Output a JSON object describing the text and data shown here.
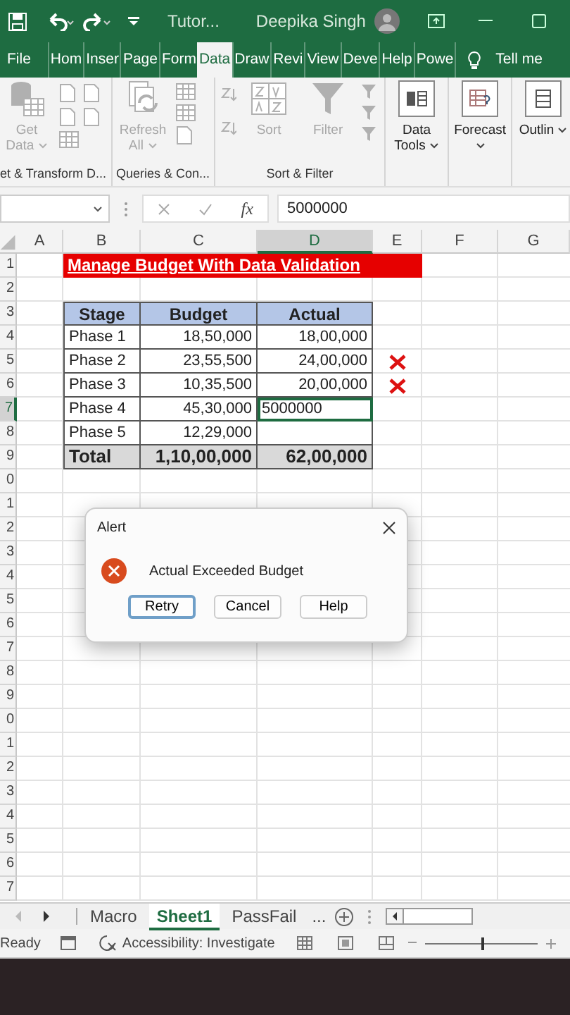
{
  "title_bar": {
    "file_name": "Tutor...",
    "user_name": "Deepika Singh"
  },
  "ribbon_tabs": [
    {
      "label": "File",
      "selected": false
    },
    {
      "label": "Hom",
      "selected": false
    },
    {
      "label": "Inser",
      "selected": false
    },
    {
      "label": "Page",
      "selected": false
    },
    {
      "label": "Form",
      "selected": false
    },
    {
      "label": "Data",
      "selected": true
    },
    {
      "label": "Draw",
      "selected": false
    },
    {
      "label": "Revi",
      "selected": false
    },
    {
      "label": "View",
      "selected": false
    },
    {
      "label": "Deve",
      "selected": false
    },
    {
      "label": "Help",
      "selected": false
    },
    {
      "label": "Powe",
      "selected": false
    }
  ],
  "tell_me": "Tell me",
  "ribbon_groups": [
    {
      "label": "et & Transform D...",
      "buttons": [
        {
          "kind": "database",
          "label": "Get Data",
          "disabled": true,
          "caret": true
        }
      ],
      "kind": "docs"
    },
    {
      "label": "Queries & Con...",
      "buttons": [
        {
          "kind": "refresh",
          "label": "Refresh All",
          "disabled": true,
          "caret": true
        }
      ],
      "kind": "list"
    },
    {
      "label": "Sort & Filter",
      "buttons": [
        {
          "kind": "sort",
          "label": "Sort",
          "disabled": true,
          "caret": false
        },
        {
          "kind": "filter",
          "label": "Filter",
          "disabled": true,
          "caret": false
        }
      ],
      "kind": "filters"
    },
    {
      "buttons": [
        {
          "kind": "tools",
          "label": "Data Tools",
          "disabled": false,
          "caret": true
        }
      ]
    },
    {
      "buttons": [
        {
          "kind": "forecast",
          "label": "Forecast",
          "disabled": false,
          "caret": true
        }
      ]
    },
    {
      "buttons": [
        {
          "kind": "outline",
          "label": "Outlin",
          "disabled": false,
          "caret": true
        }
      ]
    }
  ],
  "formula_bar": {
    "function_label": "fx",
    "value": "5000000"
  },
  "columns": [
    {
      "label": "A",
      "selected": false
    },
    {
      "label": "B",
      "selected": false
    },
    {
      "label": "C",
      "selected": false
    },
    {
      "label": "D",
      "selected": true
    },
    {
      "label": "E",
      "selected": false
    },
    {
      "label": "F",
      "selected": false
    },
    {
      "label": "G",
      "selected": false
    }
  ],
  "row_headers": [
    {
      "label": "1",
      "selected": false
    },
    {
      "label": "2",
      "selected": false
    },
    {
      "label": "3",
      "selected": false
    },
    {
      "label": "4",
      "selected": false
    },
    {
      "label": "5",
      "selected": false
    },
    {
      "label": "6",
      "selected": false
    },
    {
      "label": "7",
      "selected": true
    },
    {
      "label": "8",
      "selected": false
    },
    {
      "label": "9",
      "selected": false
    },
    {
      "label": "0",
      "selected": false
    },
    {
      "label": "1",
      "selected": false
    },
    {
      "label": "2",
      "selected": false
    },
    {
      "label": "3",
      "selected": false
    },
    {
      "label": "4",
      "selected": false
    },
    {
      "label": "5",
      "selected": false
    },
    {
      "label": "6",
      "selected": false
    },
    {
      "label": "7",
      "selected": false
    },
    {
      "label": "8",
      "selected": false
    },
    {
      "label": "9",
      "selected": false
    },
    {
      "label": "0",
      "selected": false
    },
    {
      "label": "1",
      "selected": false
    },
    {
      "label": "2",
      "selected": false
    },
    {
      "label": "3",
      "selected": false
    },
    {
      "label": "4",
      "selected": false
    },
    {
      "label": "5",
      "selected": false
    },
    {
      "label": "6",
      "selected": false
    },
    {
      "label": "7",
      "selected": false
    }
  ],
  "sheet_title": "Manage Budget With Data Validation",
  "table": {
    "columns": [
      "Stage",
      "Budget",
      "Actual"
    ],
    "rows": [
      {
        "stage": "Phase 1",
        "budget": "18,50,000",
        "actual": "18,00,000",
        "exceeded": false,
        "active": false
      },
      {
        "stage": "Phase 2",
        "budget": "23,55,500",
        "actual": "24,00,000",
        "exceeded": true,
        "active": false
      },
      {
        "stage": "Phase 3",
        "budget": "10,35,500",
        "actual": "20,00,000",
        "exceeded": true,
        "active": false
      },
      {
        "stage": "Phase 4",
        "budget": "45,30,000",
        "actual": "5000000",
        "exceeded": false,
        "active": true
      },
      {
        "stage": "Phase 5",
        "budget": "12,29,000",
        "exceeded": false,
        "active": false
      }
    ],
    "total": {
      "label": "Total",
      "budget": "1,10,00,000",
      "actual": "62,00,000"
    }
  },
  "dialog": {
    "title": "Alert",
    "message": "Actual Exceeded Budget",
    "buttons": [
      {
        "label": "Retry",
        "focused": true
      },
      {
        "label": "Cancel",
        "focused": false
      },
      {
        "label": "Help",
        "focused": false
      }
    ]
  },
  "sheet_tabs": [
    {
      "label": "Macro",
      "selected": false
    },
    {
      "label": "Sheet1",
      "selected": true
    },
    {
      "label": "PassFail",
      "selected": false
    }
  ],
  "more_sheets": "...",
  "status_bar": {
    "state": "Ready",
    "accessibility": "Accessibility: Investigate",
    "zoom": {
      "level": 0.5
    }
  }
}
